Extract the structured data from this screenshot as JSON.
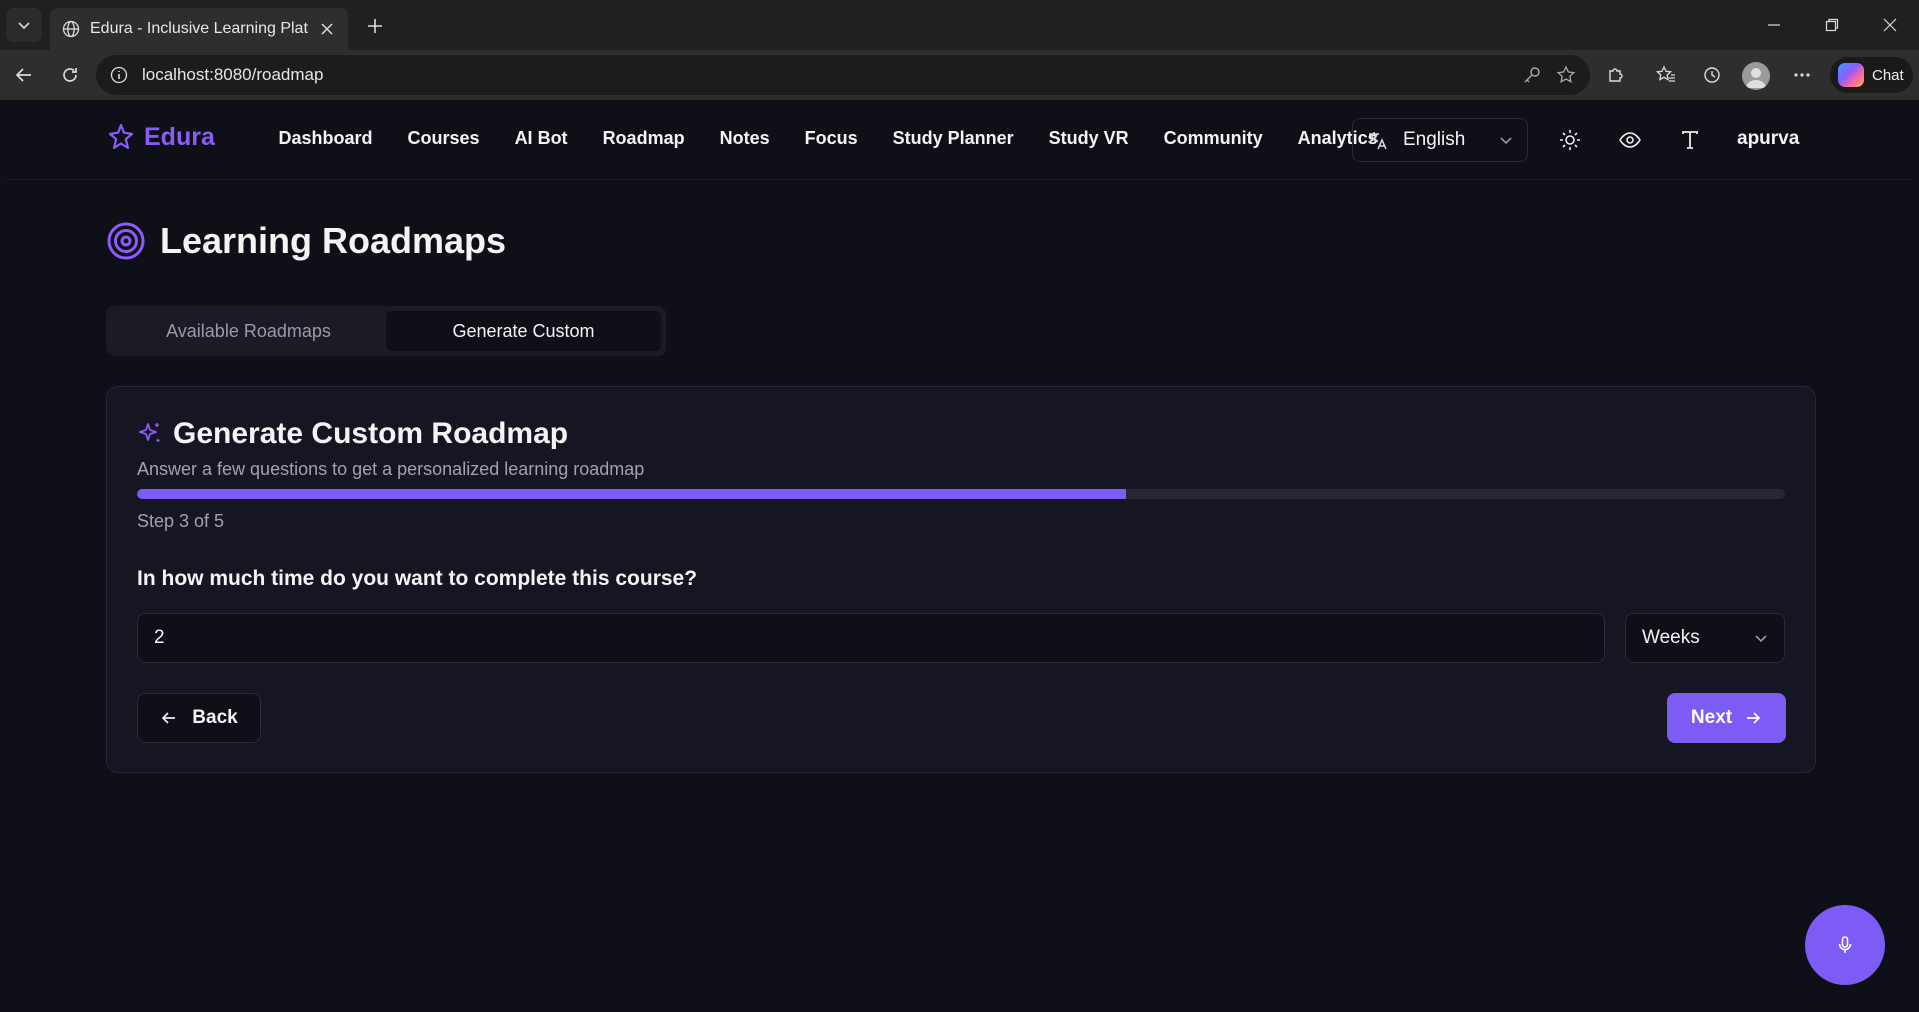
{
  "browser": {
    "tab_title": "Edura - Inclusive Learning Platform",
    "url": "localhost:8080/roadmap",
    "chat_label": "Chat"
  },
  "app": {
    "logo": "Edura",
    "nav": [
      "Dashboard",
      "Courses",
      "AI Bot",
      "Roadmap",
      "Notes",
      "Focus",
      "Study Planner",
      "Study VR",
      "Community",
      "Analytics"
    ],
    "language": "English",
    "user": "apurva"
  },
  "page": {
    "title": "Learning Roadmaps",
    "tabs": [
      {
        "label": "Available Roadmaps",
        "active": false
      },
      {
        "label": "Generate Custom",
        "active": true
      }
    ]
  },
  "card": {
    "title": "Generate Custom Roadmap",
    "subtitle": "Answer a few questions to get a personalized learning roadmap",
    "progress_fraction": 0.6,
    "step_text": "Step 3 of 5",
    "question": "In how much time do you want to complete this course?",
    "time_value": "2",
    "time_unit": "Weeks",
    "back_label": "Back",
    "next_label": "Next"
  },
  "colors": {
    "accent": "#7c5cf5",
    "background": "#0f0f17",
    "card": "#161622"
  }
}
